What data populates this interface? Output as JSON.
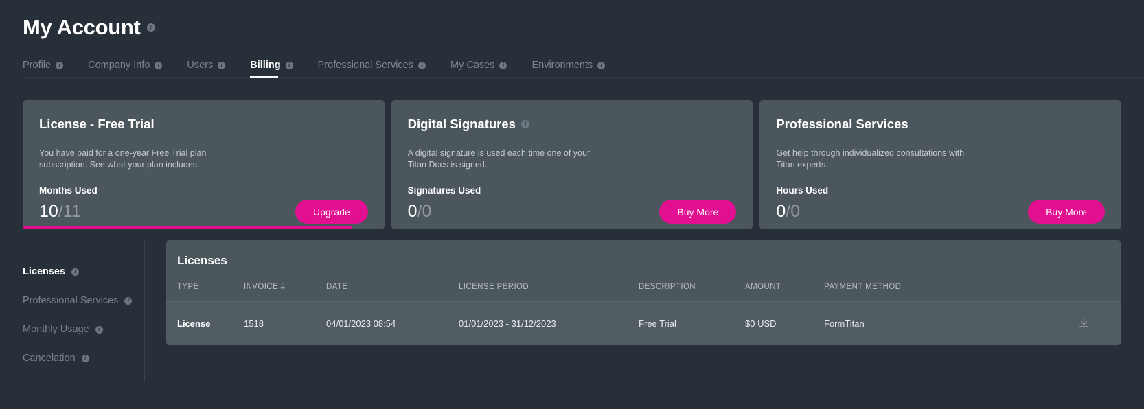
{
  "header": {
    "title": "My Account",
    "info_icon": "info-icon"
  },
  "tabs": [
    {
      "label": "Profile",
      "active": false
    },
    {
      "label": "Company Info",
      "active": false
    },
    {
      "label": "Users",
      "active": false
    },
    {
      "label": "Billing",
      "active": true
    },
    {
      "label": "Professional Services",
      "active": false
    },
    {
      "label": "My Cases",
      "active": false
    },
    {
      "label": "Environments",
      "active": false
    }
  ],
  "cards": [
    {
      "title": "License - Free Trial",
      "has_info": false,
      "description": "You have paid for a one-year Free Trial plan subscription. See what your plan includes.",
      "metric_label": "Months Used",
      "metric_value": "10",
      "metric_total": "/11",
      "button_label": "Upgrade",
      "progress_percent": 91
    },
    {
      "title": "Digital Signatures",
      "has_info": true,
      "description": "A digital signature is used each time one of your Titan Docs is signed.",
      "metric_label": "Signatures Used",
      "metric_value": "0",
      "metric_total": "/0",
      "button_label": "Buy More",
      "progress_percent": 0
    },
    {
      "title": "Professional Services",
      "has_info": false,
      "description": "Get help through individualized consultations with Titan experts.",
      "metric_label": "Hours Used",
      "metric_value": "0",
      "metric_total": "/0",
      "button_label": "Buy More",
      "progress_percent": 0
    }
  ],
  "sidebar": {
    "items": [
      {
        "label": "Licenses",
        "active": true
      },
      {
        "label": "Professional Services",
        "active": false
      },
      {
        "label": "Monthly Usage",
        "active": false
      },
      {
        "label": "Cancelation",
        "active": false
      }
    ]
  },
  "panel": {
    "title": "Licenses",
    "columns": [
      "TYPE",
      "INVOICE #",
      "DATE",
      "LICENSE PERIOD",
      "DESCRIPTION",
      "AMOUNT",
      "PAYMENT METHOD"
    ],
    "rows": [
      {
        "type": "License",
        "invoice": "1518",
        "date": "04/01/2023 08:54",
        "period": "01/01/2023 - 31/12/2023",
        "description": "Free Trial",
        "amount": "$0 USD",
        "payment_method": "FormTitan",
        "download_icon": "download-icon"
      }
    ]
  },
  "colors": {
    "page_background": "#272f38",
    "card_background": "#4c565d",
    "accent_pink": "#e30f91",
    "text_primary": "#ffffff",
    "text_muted": "#79838c"
  }
}
